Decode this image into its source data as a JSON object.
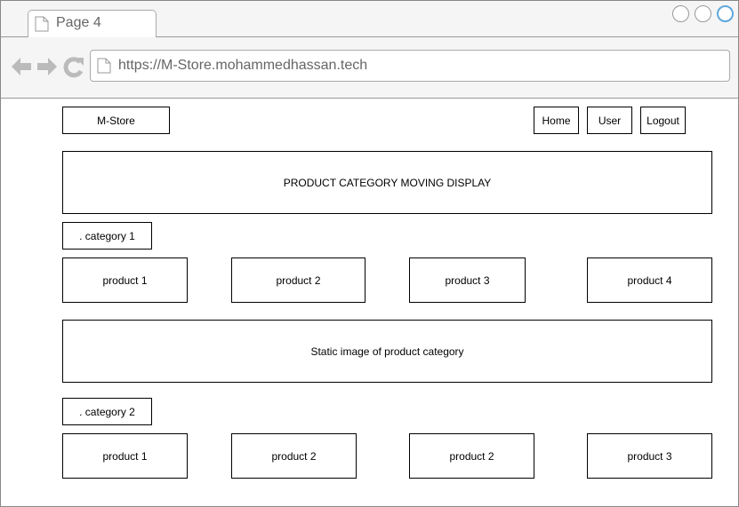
{
  "browser": {
    "tab_title": "Page 4",
    "url": "https://M-Store.mohammedhassan.tech"
  },
  "header": {
    "logo": "M-Store",
    "nav": {
      "home": "Home",
      "user": "User",
      "logout": "Logout"
    }
  },
  "banner": "PRODUCT CATEGORY MOVING DISPLAY",
  "category1": {
    "label": ". category 1",
    "products": [
      "product 1",
      "product 2",
      "product 3",
      "product 4"
    ]
  },
  "static_image": "Static image of product category",
  "category2": {
    "label": ". category 2",
    "products": [
      "product 1",
      "product 2",
      "product 2",
      "product 3"
    ]
  },
  "colors": {
    "accent": "#5fa8dc",
    "icon_gray": "#bbbbbb",
    "chrome_bg": "#f5f5f5"
  }
}
